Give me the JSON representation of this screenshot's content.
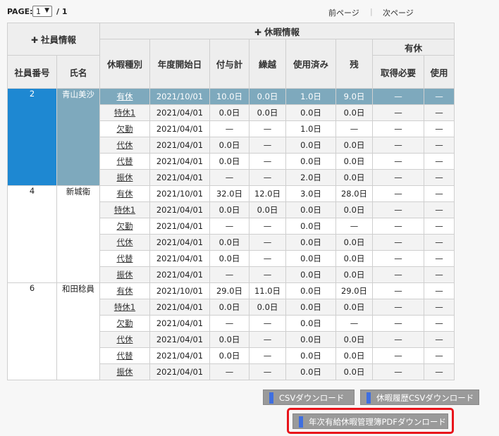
{
  "paging": {
    "label": "PAGE:",
    "current": "1",
    "total": "/ 1",
    "prev": "前ページ",
    "separator": "|",
    "next": "次ページ"
  },
  "headers": {
    "employee_group": "社員情報",
    "leave_group": "休暇情報",
    "emp_no": "社員番号",
    "emp_name": "氏名",
    "leave_type": "休暇種別",
    "year_start": "年度開始日",
    "granted": "付与計",
    "carryover": "繰越",
    "used": "使用済み",
    "remaining": "残",
    "paid_group": "有休",
    "required": "取得必要",
    "paid_used": "使用"
  },
  "employees": [
    {
      "no": "2",
      "name": "青山美沙",
      "selected": true,
      "rows": [
        [
          "有休",
          "2021/10/01",
          "10.0日",
          "0.0日",
          "1.0日",
          "9.0日",
          "—",
          "—"
        ],
        [
          "特休1",
          "2021/04/01",
          "0.0日",
          "0.0日",
          "0.0日",
          "0.0日",
          "—",
          "—"
        ],
        [
          "欠勤",
          "2021/04/01",
          "—",
          "—",
          "1.0日",
          "—",
          "—",
          "—"
        ],
        [
          "代休",
          "2021/04/01",
          "0.0日",
          "—",
          "0.0日",
          "0.0日",
          "—",
          "—"
        ],
        [
          "代替",
          "2021/04/01",
          "0.0日",
          "—",
          "0.0日",
          "0.0日",
          "—",
          "—"
        ],
        [
          "振休",
          "2021/04/01",
          "—",
          "—",
          "2.0日",
          "0.0日",
          "—",
          "—"
        ]
      ]
    },
    {
      "no": "4",
      "name": "新城衛",
      "selected": false,
      "rows": [
        [
          "有休",
          "2021/10/01",
          "32.0日",
          "12.0日",
          "3.0日",
          "28.0日",
          "—",
          "—"
        ],
        [
          "特休1",
          "2021/04/01",
          "0.0日",
          "0.0日",
          "0.0日",
          "0.0日",
          "—",
          "—"
        ],
        [
          "欠勤",
          "2021/04/01",
          "—",
          "—",
          "0.0日",
          "—",
          "—",
          "—"
        ],
        [
          "代休",
          "2021/04/01",
          "0.0日",
          "—",
          "0.0日",
          "0.0日",
          "—",
          "—"
        ],
        [
          "代替",
          "2021/04/01",
          "0.0日",
          "—",
          "0.0日",
          "0.0日",
          "—",
          "—"
        ],
        [
          "振休",
          "2021/04/01",
          "—",
          "—",
          "0.0日",
          "0.0日",
          "—",
          "—"
        ]
      ]
    },
    {
      "no": "6",
      "name": "和田稔員",
      "selected": false,
      "rows": [
        [
          "有休",
          "2021/10/01",
          "29.0日",
          "11.0日",
          "0.0日",
          "29.0日",
          "—",
          "—"
        ],
        [
          "特休1",
          "2021/04/01",
          "0.0日",
          "0.0日",
          "0.0日",
          "0.0日",
          "—",
          "—"
        ],
        [
          "欠勤",
          "2021/04/01",
          "—",
          "—",
          "0.0日",
          "—",
          "—",
          "—"
        ],
        [
          "代休",
          "2021/04/01",
          "0.0日",
          "—",
          "0.0日",
          "0.0日",
          "—",
          "—"
        ],
        [
          "代替",
          "2021/04/01",
          "0.0日",
          "—",
          "0.0日",
          "0.0日",
          "—",
          "—"
        ],
        [
          "振休",
          "2021/04/01",
          "—",
          "—",
          "0.0日",
          "0.0日",
          "—",
          "—"
        ]
      ]
    }
  ],
  "buttons": {
    "csv": "CSVダウンロード",
    "history_csv": "休暇履歴CSVダウンロード",
    "pdf": "年次有給休暇管理簿PDFダウンロード"
  },
  "colors": {
    "selected_no": "#1e88d2",
    "selected_row": "#7ea9bd",
    "button": "#9a9a9a",
    "button_mark": "#3f6fe0",
    "highlight": "#e8141b"
  }
}
